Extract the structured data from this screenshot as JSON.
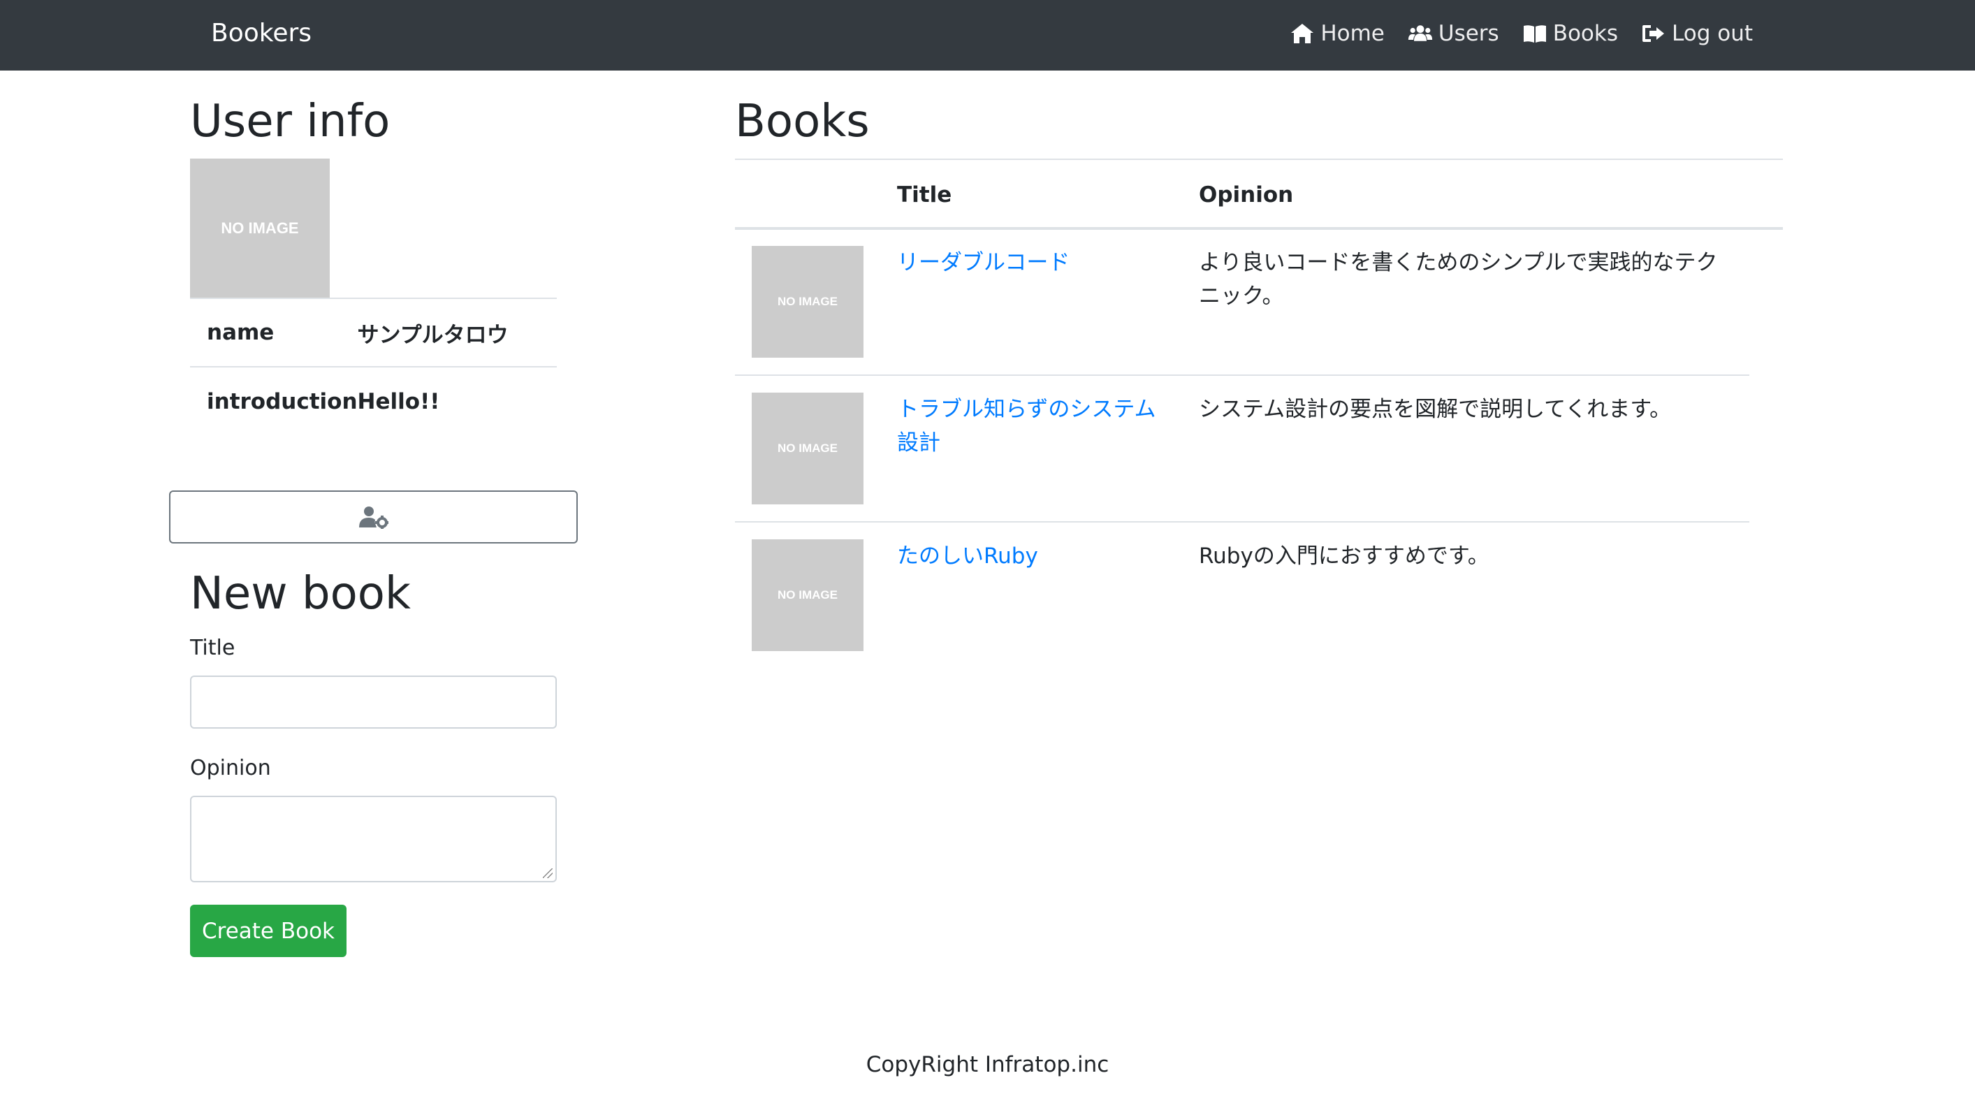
{
  "navbar": {
    "brand": "Bookers",
    "links": [
      {
        "label": "Home",
        "icon": "home-icon"
      },
      {
        "label": "Users",
        "icon": "users-icon"
      },
      {
        "label": "Books",
        "icon": "book-open-icon"
      },
      {
        "label": "Log out",
        "icon": "sign-out-icon"
      }
    ]
  },
  "user_info": {
    "heading": "User info",
    "avatar_text": "NO IMAGE",
    "rows": [
      {
        "label": "name",
        "value": "サンプルタロウ"
      },
      {
        "label": "introduction",
        "value": "Hello!!"
      }
    ],
    "edit_icon": "user-cog-icon"
  },
  "new_book": {
    "heading": "New book",
    "title_label": "Title",
    "title_value": "",
    "opinion_label": "Opinion",
    "opinion_value": "",
    "submit_label": "Create Book"
  },
  "books": {
    "heading": "Books",
    "columns": [
      "",
      "Title",
      "Opinion"
    ],
    "image_text": "NO IMAGE",
    "rows": [
      {
        "title": "リーダブルコード",
        "opinion": "より良いコードを書くためのシンプルで実践的なテクニック。"
      },
      {
        "title": "トラブル知らずのシステム設計",
        "opinion": "システム設計の要点を図解で説明してくれます。"
      },
      {
        "title": "たのしいRuby",
        "opinion": "Rubyの入門におすすめです。"
      }
    ]
  },
  "footer": {
    "text": "CopyRight Infratop.inc"
  },
  "colors": {
    "navbar_bg": "#343a40",
    "link": "#007bff",
    "success": "#28a745",
    "placeholder_image": "#cccccc"
  }
}
